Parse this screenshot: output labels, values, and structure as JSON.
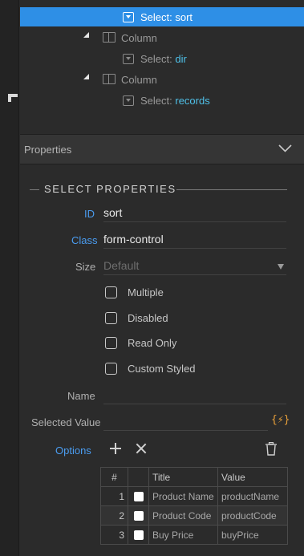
{
  "tree": {
    "rows": [
      {
        "type": "select",
        "prefix": "Select: ",
        "value": "sort",
        "selected": true
      },
      {
        "type": "column",
        "label": "Column"
      },
      {
        "type": "select",
        "prefix": "Select: ",
        "value": "dir",
        "selected": false
      },
      {
        "type": "column",
        "label": "Column"
      },
      {
        "type": "select",
        "prefix": "Select: ",
        "value": "records",
        "selected": false
      }
    ]
  },
  "properties": {
    "header": "Properties",
    "section_title": "SELECT PROPERTIES",
    "id_label": "ID",
    "id_value": "sort",
    "class_label": "Class",
    "class_value": "form-control",
    "size_label": "Size",
    "size_value": "Default",
    "checkboxes": [
      "Multiple",
      "Disabled",
      "Read Only",
      "Custom Styled"
    ],
    "name_label": "Name",
    "name_value": "",
    "selected_value_label": "Selected Value",
    "selected_value": "",
    "dynamic_icon": "{⚡}",
    "options_label": "Options"
  },
  "options_table": {
    "headers": [
      "#",
      "",
      "Title",
      "Value"
    ],
    "rows": [
      {
        "num": "1",
        "title": "Product Name",
        "value": "productName"
      },
      {
        "num": "2",
        "title": "Product Code",
        "value": "productCode"
      },
      {
        "num": "3",
        "title": "Buy Price",
        "value": "buyPrice"
      }
    ]
  },
  "colors": {
    "accent": "#2e8fe6",
    "label_blue": "#4a9cf0",
    "value_cyan": "#4fc1e9",
    "dynamic_orange": "#e8a03a"
  }
}
